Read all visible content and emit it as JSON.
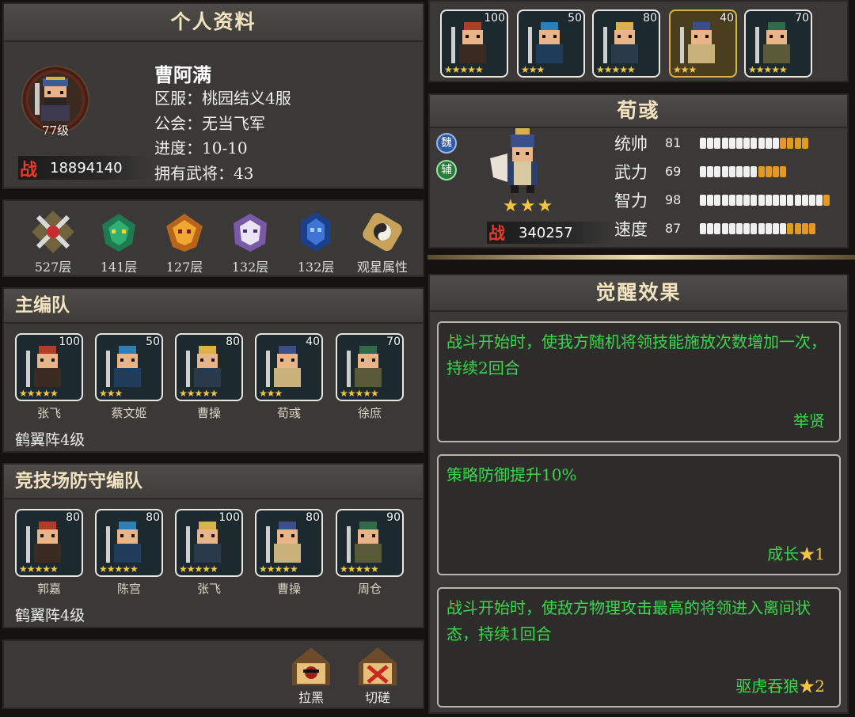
{
  "profile": {
    "title": "个人资料",
    "name": "曹阿满",
    "server": "区服：桃园结义4服",
    "guild": "公会：无当飞军",
    "progress": "进度：10-10",
    "generals": "拥有武将：43",
    "level": "77级",
    "power": "18894140",
    "power_badge": "战"
  },
  "towers": [
    {
      "label": "527层",
      "icon": "crossed-swords-icon"
    },
    {
      "label": "141层",
      "icon": "green-dragon-icon"
    },
    {
      "label": "127层",
      "icon": "phoenix-icon"
    },
    {
      "label": "132层",
      "icon": "white-tiger-icon"
    },
    {
      "label": "132层",
      "icon": "black-tortoise-icon"
    },
    {
      "label": "观星属性",
      "icon": "taiji-scroll-icon"
    }
  ],
  "main_team": {
    "title": "主编队",
    "formation": "鹤翼阵4级",
    "members": [
      {
        "name": "张飞",
        "level": "100",
        "stars": "★★★★★"
      },
      {
        "name": "蔡文姬",
        "level": "50",
        "stars": "★★★"
      },
      {
        "name": "曹操",
        "level": "80",
        "stars": "★★★★★"
      },
      {
        "name": "荀彧",
        "level": "40",
        "stars": "★★★"
      },
      {
        "name": "徐庶",
        "level": "70",
        "stars": "★★★★★"
      }
    ]
  },
  "arena_team": {
    "title": "竞技场防守编队",
    "formation": "鹤翼阵4级",
    "members": [
      {
        "name": "郭嘉",
        "level": "80",
        "stars": "★★★★★"
      },
      {
        "name": "陈宫",
        "level": "80",
        "stars": "★★★★★"
      },
      {
        "name": "张飞",
        "level": "100",
        "stars": "★★★★★"
      },
      {
        "name": "曹操",
        "level": "80",
        "stars": "★★★★★"
      },
      {
        "name": "周仓",
        "level": "90",
        "stars": "★★★★★"
      }
    ]
  },
  "actions": {
    "block": "拉黑",
    "duel": "切磋"
  },
  "top_strip": {
    "levels": [
      "100",
      "50",
      "80",
      "40",
      "70"
    ],
    "stars": [
      "★★★★★",
      "★★★",
      "★★★★★",
      "★★★",
      "★★★★★"
    ]
  },
  "hero": {
    "name": "荀彧",
    "faction": "魏",
    "role": "辅",
    "stars": "★★★",
    "power_badge": "战",
    "power": "340257",
    "stats": [
      {
        "label": "统帅",
        "value": "81",
        "level": 0.81
      },
      {
        "label": "武力",
        "value": "69",
        "level": 0.69
      },
      {
        "label": "智力",
        "value": "98",
        "level": 0.98
      },
      {
        "label": "速度",
        "value": "87",
        "level": 0.87
      }
    ]
  },
  "awakening": {
    "title": "觉醒效果",
    "effects": [
      {
        "text": "战斗开始时，使我方随机将领技能施放次数增加一次，持续2回合",
        "tag": "举贤"
      },
      {
        "text": "策略防御提升10%",
        "tag": "成长",
        "tag_stars": "★1"
      },
      {
        "text": "战斗开始时，使敌方物理攻击最高的将领进入离间状态，持续1回合",
        "tag": "驱虎吞狼",
        "tag_stars": "★2"
      }
    ]
  },
  "colors": {
    "effect_text": "#39d74a",
    "bar_fill": "#f1f1f1",
    "bar_tail": "#e39a1f",
    "header_text": "#f3e3c0"
  }
}
